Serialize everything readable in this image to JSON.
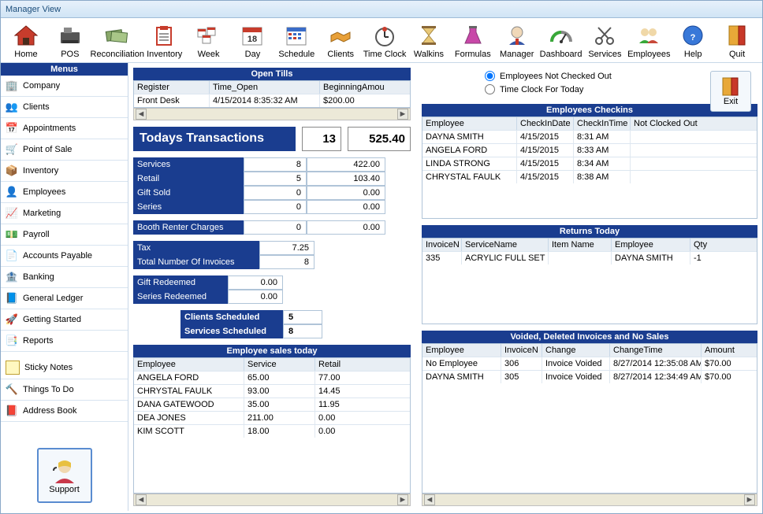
{
  "window": {
    "title": "Manager View"
  },
  "toolbar": [
    {
      "name": "home",
      "label": "Home"
    },
    {
      "name": "pos",
      "label": "POS"
    },
    {
      "name": "reconciliation",
      "label": "Reconciliation"
    },
    {
      "name": "inventory",
      "label": "Inventory"
    },
    {
      "name": "week",
      "label": "Week"
    },
    {
      "name": "day",
      "label": "Day"
    },
    {
      "name": "schedule",
      "label": "Schedule"
    },
    {
      "name": "clients",
      "label": "Clients"
    },
    {
      "name": "timeclock",
      "label": "Time Clock"
    },
    {
      "name": "walkins",
      "label": "Walkins"
    },
    {
      "name": "formulas",
      "label": "Formulas"
    },
    {
      "name": "manager",
      "label": "Manager"
    },
    {
      "name": "dashboard",
      "label": "Dashboard"
    },
    {
      "name": "services",
      "label": "Services"
    },
    {
      "name": "employees",
      "label": "Employees"
    },
    {
      "name": "help",
      "label": "Help"
    },
    {
      "name": "quit",
      "label": "Quit"
    }
  ],
  "sidebar": {
    "header": "Menus",
    "items": [
      {
        "name": "company",
        "label": "Company"
      },
      {
        "name": "clients",
        "label": "Clients"
      },
      {
        "name": "appointments",
        "label": "Appointments"
      },
      {
        "name": "pointofsale",
        "label": "Point of Sale"
      },
      {
        "name": "inventory",
        "label": "Inventory"
      },
      {
        "name": "employees",
        "label": "Employees"
      },
      {
        "name": "marketing",
        "label": "Marketing"
      },
      {
        "name": "payroll",
        "label": "Payroll"
      },
      {
        "name": "accountspayable",
        "label": "Accounts Payable"
      },
      {
        "name": "banking",
        "label": "Banking"
      },
      {
        "name": "generalledger",
        "label": "General Ledger"
      },
      {
        "name": "gettingstarted",
        "label": "Getting Started"
      },
      {
        "name": "reports",
        "label": "Reports"
      }
    ],
    "extras": [
      {
        "name": "stickynotes",
        "label": "Sticky Notes"
      },
      {
        "name": "thingstodo",
        "label": "Things To Do"
      },
      {
        "name": "addressbook",
        "label": "Address Book"
      }
    ],
    "support": "Support"
  },
  "openTills": {
    "title": "Open Tills",
    "headers": [
      "Register",
      "Time_Open",
      "BeginningAmou"
    ],
    "rows": [
      {
        "register": "Front Desk",
        "time": "4/15/2014 8:35:32 AM",
        "amount": "$200.00"
      }
    ]
  },
  "transactions": {
    "title": "Todays Transactions",
    "count": "13",
    "total": "525.40",
    "lines": [
      {
        "label": "Services",
        "count": "8",
        "amount": "422.00"
      },
      {
        "label": "Retail",
        "count": "5",
        "amount": "103.40"
      },
      {
        "label": "Gift  Sold",
        "count": "0",
        "amount": "0.00"
      },
      {
        "label": "Series",
        "count": "0",
        "amount": "0.00"
      }
    ],
    "booth": {
      "label": "Booth Renter Charges",
      "count": "0",
      "amount": "0.00"
    },
    "tax": {
      "label": "Tax",
      "amount": "7.25"
    },
    "totalInv": {
      "label": "Total Number Of Invoices",
      "count": "8"
    },
    "giftRedeemed": {
      "label": "Gift  Redeemed",
      "amount": "0.00"
    },
    "seriesRedeemed": {
      "label": "Series Redeemed",
      "amount": "0.00"
    },
    "clientsScheduled": {
      "label": "Clients Scheduled",
      "count": "5"
    },
    "servicesScheduled": {
      "label": "Services Scheduled",
      "count": "8"
    }
  },
  "employeeSales": {
    "title": "Employee sales today",
    "headers": [
      "Employee",
      "Service",
      "Retail"
    ],
    "rows": [
      {
        "emp": "ANGELA FORD",
        "svc": "65.00",
        "ret": "77.00"
      },
      {
        "emp": "CHRYSTAL FAULK",
        "svc": "93.00",
        "ret": "14.45"
      },
      {
        "emp": "DANA GATEWOOD",
        "svc": "35.00",
        "ret": "11.95"
      },
      {
        "emp": "DEA JONES",
        "svc": "211.00",
        "ret": "0.00"
      },
      {
        "emp": "KIM SCOTT",
        "svc": "18.00",
        "ret": "0.00"
      }
    ]
  },
  "rightTop": {
    "radio1": "Employees Not Checked Out",
    "radio2": "Time Clock For Today",
    "exit": "Exit"
  },
  "checkins": {
    "title": "Employees Checkins",
    "headers": [
      "Employee",
      "CheckInDate",
      "CheckInTime",
      "Not Clocked Out"
    ],
    "rows": [
      {
        "emp": "DAYNA SMITH",
        "date": "4/15/2015",
        "time": "8:31 AM",
        "out": ""
      },
      {
        "emp": "ANGELA FORD",
        "date": "4/15/2015",
        "time": "8:33 AM",
        "out": ""
      },
      {
        "emp": "LINDA STRONG",
        "date": "4/15/2015",
        "time": "8:34 AM",
        "out": ""
      },
      {
        "emp": "CHRYSTAL FAULK",
        "date": "4/15/2015",
        "time": "8:38 AM",
        "out": ""
      }
    ]
  },
  "returns": {
    "title": "Returns Today",
    "headers": [
      "InvoiceN",
      "ServiceName",
      "Item Name",
      "Employee",
      "Qty"
    ],
    "rows": [
      {
        "inv": "335",
        "svc": "ACRYLIC FULL SET",
        "item": "",
        "emp": "DAYNA SMITH",
        "qty": "-1"
      }
    ]
  },
  "voided": {
    "title": "Voided, Deleted Invoices and No Sales",
    "headers": [
      "Employee",
      "InvoiceN",
      "Change",
      "ChangeTime",
      "Amount"
    ],
    "rows": [
      {
        "emp": "No Employee",
        "inv": "306",
        "chg": "Invoice Voided",
        "time": "8/27/2014 12:35:08 AM",
        "amt": "$70.00"
      },
      {
        "emp": "DAYNA SMITH",
        "inv": "305",
        "chg": "Invoice Voided",
        "time": "8/27/2014 12:34:49 AM",
        "amt": "$70.00"
      }
    ]
  }
}
